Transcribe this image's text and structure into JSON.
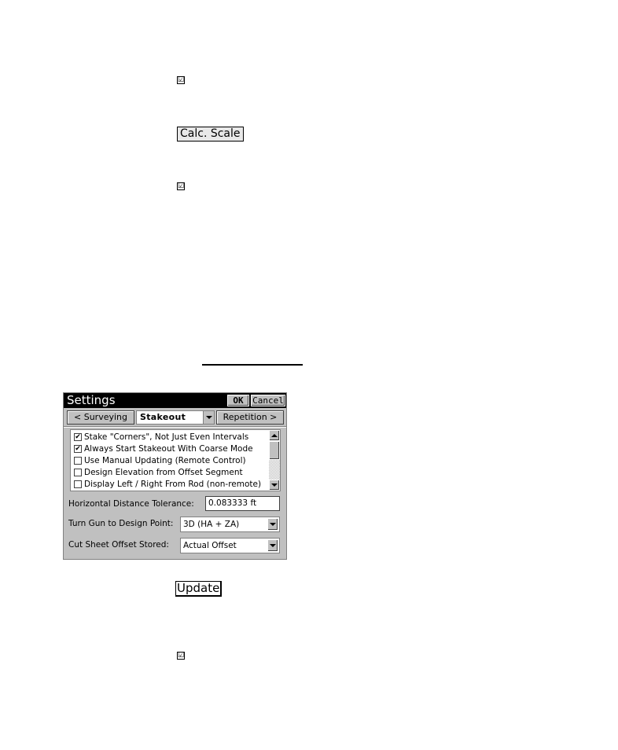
{
  "document": {
    "check_glyph": "☑",
    "calc_scale_button": "Calc. Scale",
    "update_button": "Update"
  },
  "dialog": {
    "title": "Settings",
    "ok_label": "OK",
    "cancel_label": "Cancel",
    "prev_label": "< Surveying",
    "next_label": "Repetition >",
    "category": "Stakeout",
    "options": [
      {
        "label": "Stake \"Corners\", Not Just Even Intervals",
        "checked": true
      },
      {
        "label": "Always Start Stakeout With Coarse Mode",
        "checked": true
      },
      {
        "label": "Use Manual Updating (Remote Control)",
        "checked": false
      },
      {
        "label": "Design Elevation from Offset Segment",
        "checked": false
      },
      {
        "label": "Display Left / Right From Rod (non-remote)",
        "checked": false
      }
    ],
    "check_mark": "✔",
    "fields": {
      "hdist_label": "Horizontal Distance Tolerance:",
      "hdist_value": "0.083333 ft",
      "turngun_label": "Turn Gun to Design Point:",
      "turngun_value": "3D (HA + ZA)",
      "cutsheet_label": "Cut Sheet Offset Stored:",
      "cutsheet_value": "Actual Offset"
    }
  }
}
